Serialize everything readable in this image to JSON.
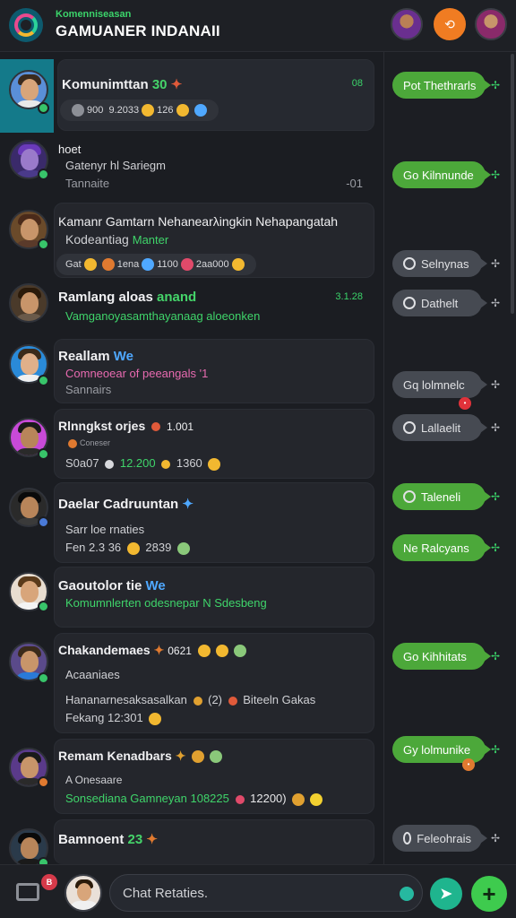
{
  "header": {
    "subtitle": "Komenniseasan",
    "title": "GAMUANER INDANAII",
    "action_icon": "share-icon"
  },
  "composer": {
    "placeholder": "Chat Retaties.",
    "badge": "B"
  },
  "chats": [
    {
      "name": "Komunimttan",
      "name_hl": "30",
      "time": "08",
      "lines": [],
      "chips": [
        "900",
        "9.2033",
        "126"
      ]
    },
    {
      "name": "hoet",
      "name_hl": "",
      "time": "",
      "lines": [
        "Gatenyr hl Sariegm",
        "Tannaite"
      ],
      "meta": "-01"
    },
    {
      "name": "Kamanr Gamtarn Nehanearλingkin Nehapangatah",
      "name_hl": "",
      "time": "",
      "lines": [
        "Kodeantiag"
      ],
      "line_hl": "Manter",
      "chips": [
        "Gat",
        "1ena",
        "1100",
        "2aa000"
      ]
    },
    {
      "name": "Ramlang aloas",
      "name_hl": "anand",
      "time": "3.1.28",
      "lines": [
        "Vamganoyasamthayanaag aloeonken"
      ]
    },
    {
      "name": "Reallam",
      "name_hl": "We",
      "time": "",
      "lines": [
        "Comneoear of peeangals '1",
        "Sannairs"
      ]
    },
    {
      "name": "Rlnngkst orjes",
      "name_hl": "1.001",
      "time": "",
      "lines": [
        "Coneser",
        "S0a07",
        "12.200",
        "1360"
      ]
    },
    {
      "name": "Daelar Cadruuntan",
      "name_hl": "",
      "time": "",
      "lines": [
        "Sarr loe rnaties",
        "Fen 2.3 36",
        "2839"
      ]
    },
    {
      "name": "Gaoutolor tie",
      "name_hl": "We",
      "time": "",
      "lines": [
        "Komumnlerten odesnepar N Sdesbeng"
      ]
    },
    {
      "name": "Chakandemaes",
      "name_hl": "0621",
      "time": "",
      "lines": [
        "Acaaniaes",
        "Hananarnesaksasalkan",
        "(2)",
        "Biteeln Gakas",
        "Fekang 12:301"
      ]
    },
    {
      "name": "Remam Kenadbars",
      "name_hl": "",
      "time": "",
      "lines": [
        "A Onesaare",
        "Sonsediana Gamneyan 108225",
        "12200)"
      ]
    },
    {
      "name": "Bamnoent",
      "name_hl": "23",
      "time": "",
      "lines": []
    }
  ],
  "quick_replies": [
    {
      "label": "Pot Thethrarls",
      "style": "green"
    },
    {
      "label": "Go Kilnnunde",
      "style": "green"
    },
    {
      "label": "Selnynas",
      "style": "gray"
    },
    {
      "label": "Dathelt",
      "style": "gray"
    },
    {
      "label": "Gq lolmnelc",
      "style": "gray"
    },
    {
      "label": "Lallaelit",
      "style": "gray"
    },
    {
      "label": "Taleneli",
      "style": "green"
    },
    {
      "label": "Ne Ralcyans",
      "style": "green"
    },
    {
      "label": "Go Kihhitats",
      "style": "green"
    },
    {
      "label": "Gy lolmunike",
      "style": "green"
    },
    {
      "label": "Feleohrais",
      "style": "gray"
    }
  ],
  "icons": [
    "app-logo-icon",
    "inbox-icon",
    "emoji-icon",
    "send-icon",
    "plus-icon",
    "reply-icon",
    "verified-check-icon"
  ],
  "colors": {
    "accent_green": "#4ca83a",
    "teal": "#147a8a",
    "orange": "#f07c22"
  }
}
